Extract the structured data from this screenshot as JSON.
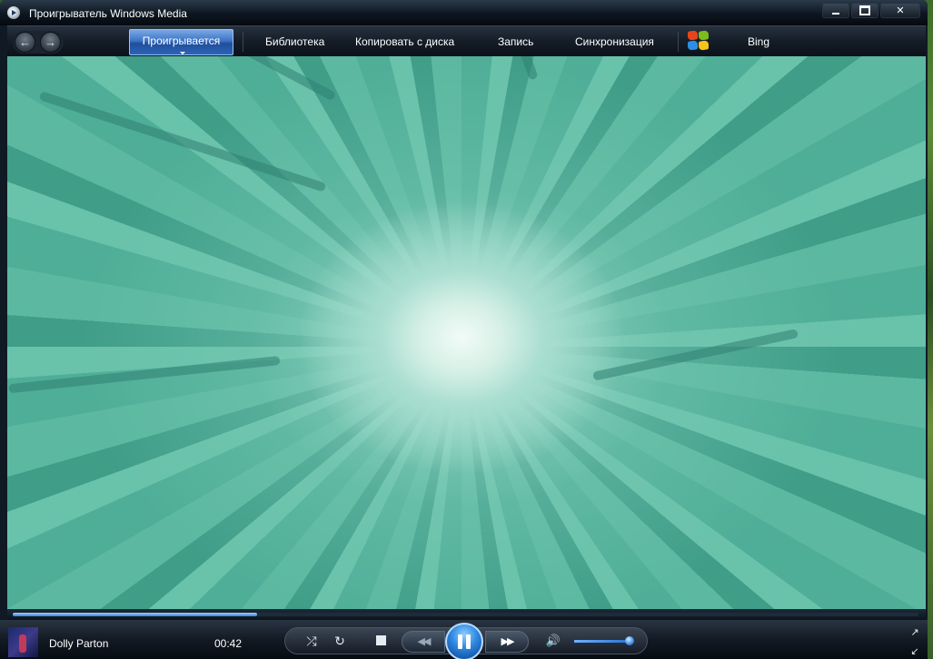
{
  "window": {
    "title": "Проигрыватель Windows Media",
    "controls": {
      "minimize": "minimize-icon",
      "maximize": "maximize-icon",
      "close": "✕"
    }
  },
  "nav": {
    "active_tab": "Проигрывается",
    "tabs": [
      "Библиотека",
      "Копировать с диска",
      "Запись",
      "Синхронизация",
      "Bing"
    ]
  },
  "now_playing": {
    "artist": "Dolly Parton",
    "time": "00:42",
    "progress": 0.27
  },
  "controls": {
    "shuffle": "⤮",
    "repeat": "↻",
    "prev": "◀◀",
    "next": "▶▶",
    "mute": "🔊",
    "volume": 0.93
  },
  "colors": {
    "visualization": "#58b49b",
    "accent": "#2c86e0"
  }
}
